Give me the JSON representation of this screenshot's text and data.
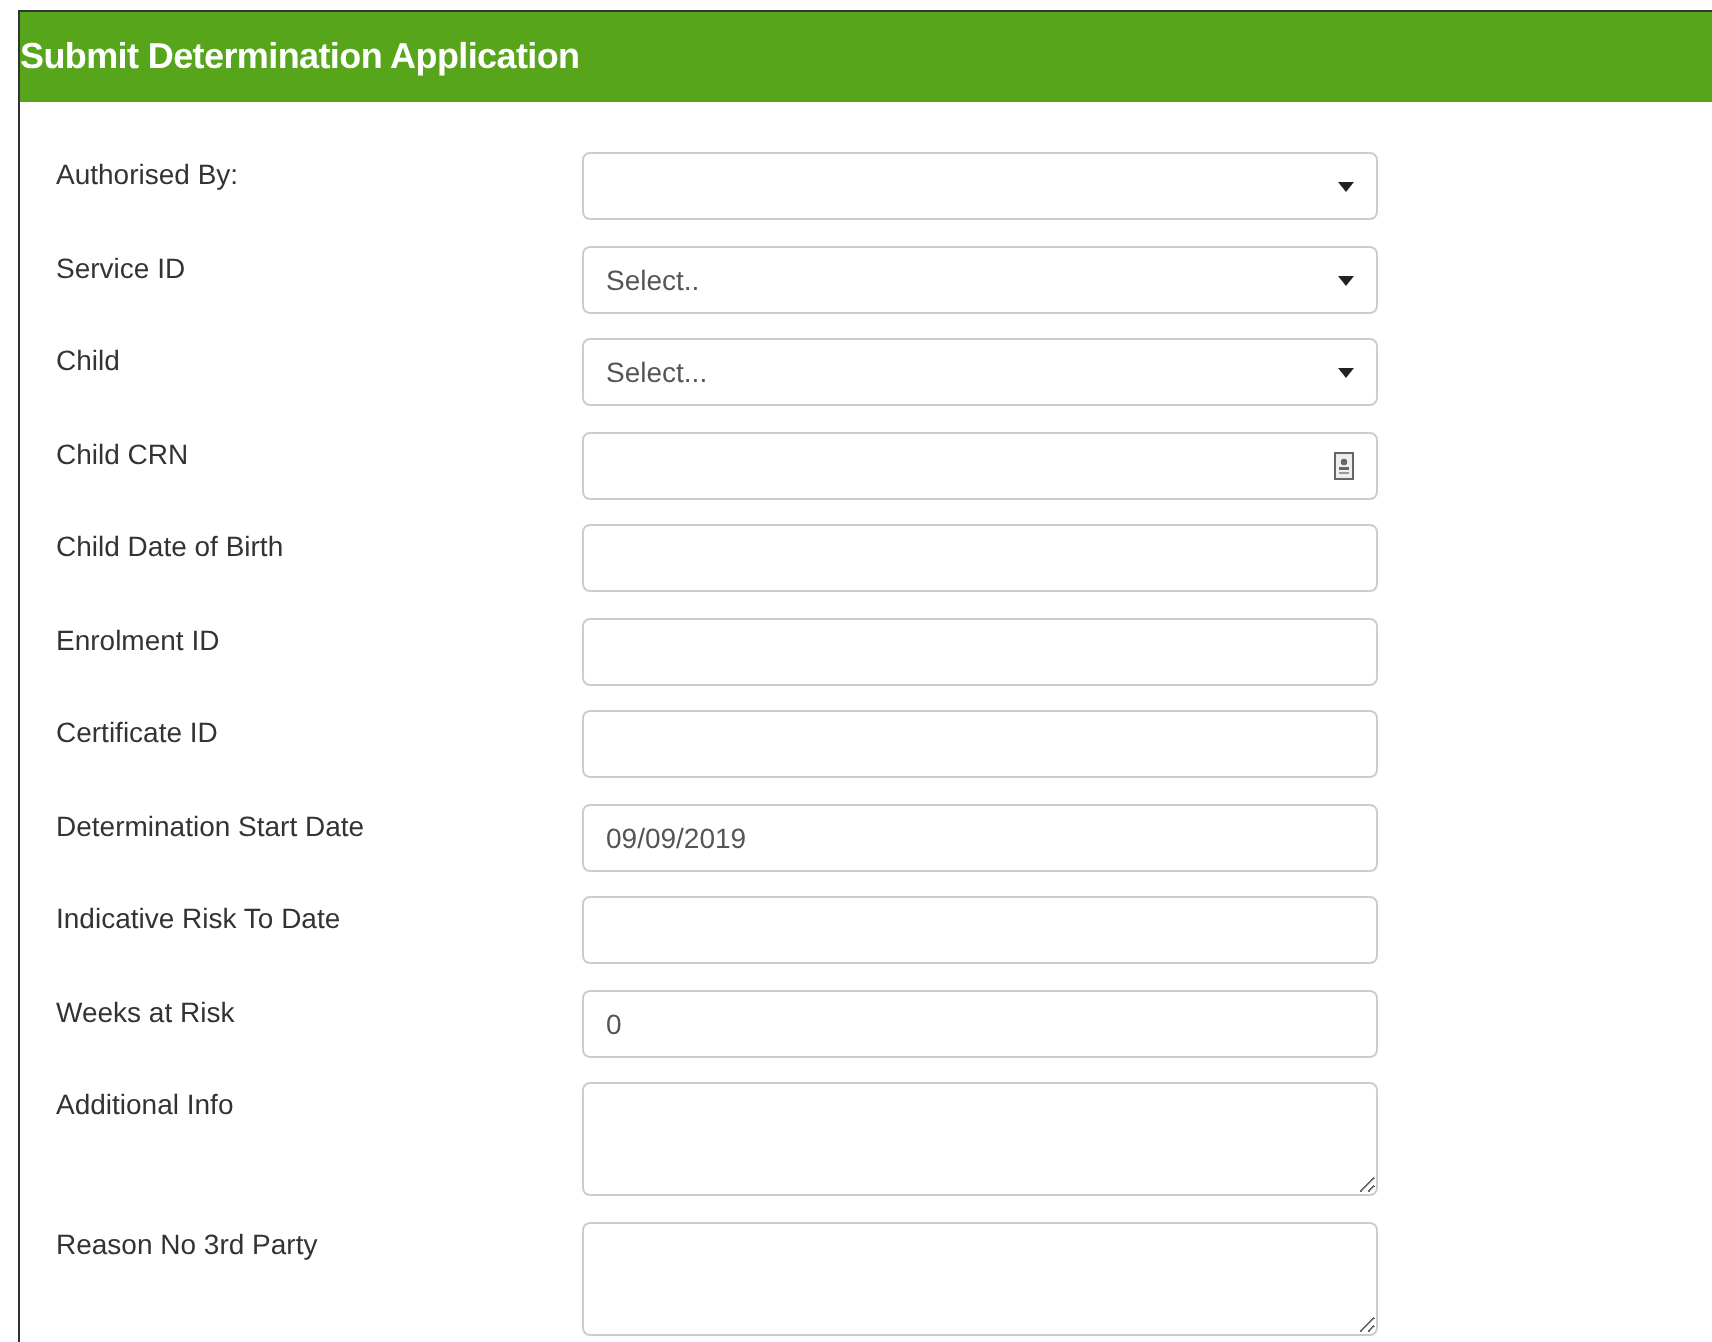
{
  "dialog": {
    "title": "Submit Determination Application"
  },
  "fields": [
    {
      "label": "Authorised By:",
      "kind": "select"
    },
    {
      "label": "Service ID",
      "kind": "select",
      "placeholder": "Select.."
    },
    {
      "label": "Child",
      "kind": "select",
      "placeholder": "Select..."
    },
    {
      "label": "Child CRN",
      "kind": "lookup"
    },
    {
      "label": "Child Date of Birth",
      "kind": "text"
    },
    {
      "label": "Enrolment ID",
      "kind": "text"
    },
    {
      "label": "Certificate ID",
      "kind": "text"
    },
    {
      "label": "Determination Start Date",
      "kind": "text",
      "value": "09/09/2019"
    },
    {
      "label": "Indicative Risk To Date",
      "kind": "text"
    },
    {
      "label": "Weeks at Risk",
      "kind": "text",
      "value": "0"
    },
    {
      "label": "Additional Info",
      "kind": "textarea"
    },
    {
      "label": "Reason No 3rd Party",
      "kind": "textarea"
    }
  ]
}
